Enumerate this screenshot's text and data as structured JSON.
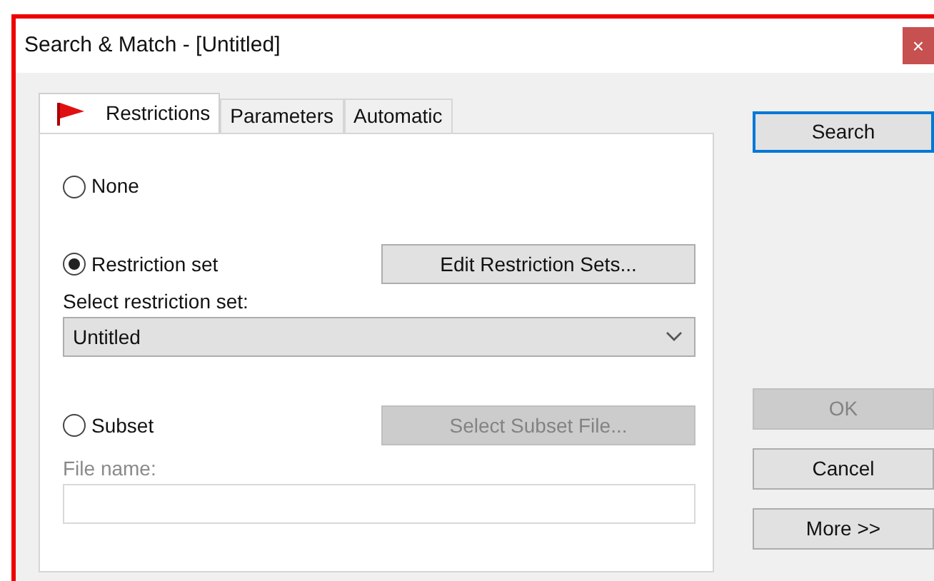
{
  "window": {
    "title": "Search & Match - [Untitled]",
    "close": "×"
  },
  "tabs": [
    {
      "label": "Restrictions",
      "selected": true
    },
    {
      "label": "Parameters",
      "selected": false
    },
    {
      "label": "Automatic",
      "selected": false
    }
  ],
  "options": [
    {
      "label": "None",
      "selected": false
    },
    {
      "label": "Restriction set",
      "selected": true,
      "button": {
        "label": "Edit Restriction Sets...",
        "disabled": false
      },
      "select": {
        "label": "Select restriction set:",
        "value": "Untitled"
      }
    },
    {
      "label": "Subset",
      "selected": false,
      "button": {
        "label": "Select Subset File...",
        "disabled": true
      },
      "field": {
        "label": "File name:",
        "disabled": true
      }
    }
  ],
  "buttons": [
    {
      "label": "Search",
      "default": true,
      "disabled": false
    },
    {
      "label": "OK",
      "default": false,
      "disabled": true
    },
    {
      "label": "Cancel",
      "default": false,
      "disabled": false
    },
    {
      "label": "More >>",
      "default": false,
      "disabled": false
    }
  ]
}
